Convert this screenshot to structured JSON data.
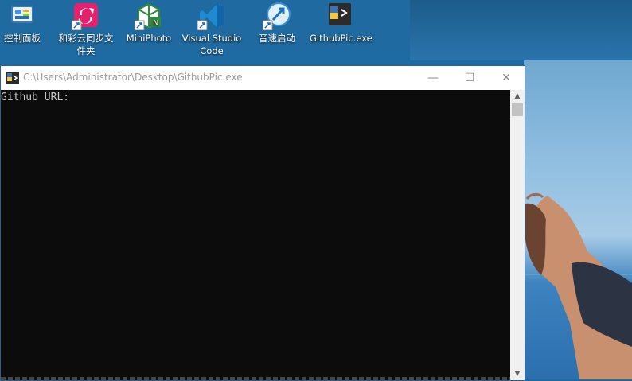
{
  "desktop": {
    "icons": [
      {
        "label": "控制面板",
        "name": "control-panel-icon"
      },
      {
        "label": "和彩云同步文件夹",
        "name": "hecaiyun-sync-folder-icon"
      },
      {
        "label": "MiniPhoto",
        "name": "miniphoto-icon"
      },
      {
        "label": "Visual Studio Code",
        "name": "vscode-icon"
      },
      {
        "label": "音速启动",
        "name": "yinsu-launcher-icon"
      },
      {
        "label": "GithubPic.exe",
        "name": "githubpic-exe-icon"
      }
    ]
  },
  "window": {
    "title": "C:\\Users\\Administrator\\Desktop\\GithubPic.exe",
    "minimize": "—",
    "maximize": "☐",
    "close": "✕"
  },
  "console": {
    "prompt": "Github URL:"
  },
  "scrollbar": {
    "up": "▲",
    "down": "▼"
  },
  "colors": {
    "console_bg": "#0c0c0c",
    "console_text": "#cccccc",
    "titlebar_bg": "#ffffff",
    "desktop_bg": "#1f6aa0"
  }
}
